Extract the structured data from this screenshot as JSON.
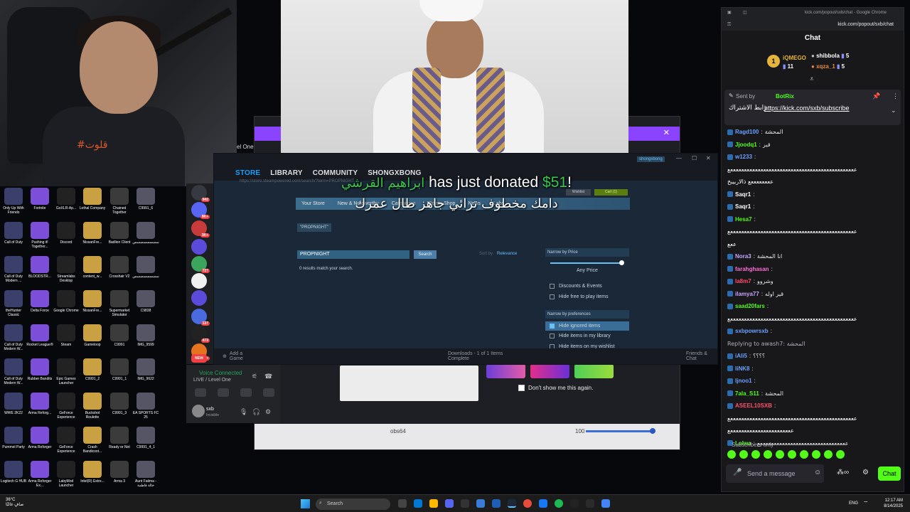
{
  "donation": {
    "name": "ابراهيم القرشي",
    "text": "has just donated",
    "amount": "$51",
    "exclaim": "!",
    "message": "دامك مخطوف ترائي جاهز طال عمرك"
  },
  "webcam": {
    "shirt_text": "#قلوت"
  },
  "steam": {
    "nav": [
      "STORE",
      "LIBRARY",
      "COMMUNITY",
      "SHONGXBONG"
    ],
    "url": "https://store.steampowered.com/search/?term=PROPNIGHT",
    "store_nav": [
      "Your Store",
      "New & Noteworthy",
      "Categories",
      "Points Shop",
      "News",
      "Labs"
    ],
    "wishlist": "Wishlist",
    "cart": "Cart (1)",
    "tag": "\"PROPNIGHT\"",
    "search_value": "PROPNIGHT",
    "search_btn": "Search",
    "sort_label": "Sort by",
    "sort_value": "Relevance",
    "no_results": "0 results match your search.",
    "price_head": "Narrow by Price",
    "any_price": "Any Price",
    "opt_discounts": "Discounts & Events",
    "opt_hide_free": "Hide free to play items",
    "pref_head": "Narrow by preferences",
    "opt_ignored": "Hide ignored items",
    "opt_library": "Hide items in my library",
    "opt_wishlist": "Hide items on my wishlist",
    "add_game": "Add a Game",
    "downloads": "Downloads - 1 of 1 Items Complete",
    "friends": "Friends & Chat",
    "user_pill": "shongxbong"
  },
  "obs": {
    "label": "obs64",
    "volume": "100",
    "dont_show": "Don't show me this again.",
    "window_title": "el One"
  },
  "discord": {
    "badges": [
      "942",
      "9K+",
      "3K+",
      "727",
      "137",
      "473",
      "9K+",
      "NEW"
    ],
    "voice_connected": "Voice Connected",
    "live_text": "LIVE / Level One",
    "user": "sxb",
    "status": "Invisible"
  },
  "desktop_icons": [
    "Only Up With Friends",
    "Fortnite",
    "GoXLR-Ap...",
    "Lethal Company",
    "Chained Together",
    "C9991_6",
    "Call of Duty",
    "Pushing it! Together...",
    "Discord",
    "NissanFre...",
    "Badlion Client",
    "سسسسسسسس",
    "Call of Duty Modern ...",
    "BLOODSTR...",
    "Streamlabs Desktop",
    "content_w...",
    "Crosshair V2",
    "سسسسسسسس",
    "theHunter Classic",
    "Delta Force",
    "Google Chrome",
    "NissanFre...",
    "Supermarket Simulator",
    "C9838",
    "Call of Duty Modern W...",
    "Rocket League®",
    "Steam",
    "Gameloop",
    "C9991",
    "IMG_9599",
    "Call of Duty Modern W...",
    "Rubber Bandits",
    "Epic Games Launcher",
    "C9991_2",
    "C9991_1",
    "IMG_9622",
    "WWE 2K22",
    "Arma Reforg...",
    "GeForce Experience",
    "Buckshot Roulette",
    "C9991_3",
    "EA SPORTS FC 25",
    "Pummel Party",
    "Arma Reforger",
    "GeForce Experience",
    "Crash Bandicoot...",
    "Ready or Not",
    "C9991_4_1",
    "Logitech G HUB",
    "Arma Reforger Ex...",
    "LabyMod Launcher",
    "Intel(R) Extre...",
    "Arma 3",
    "Aunt Fatima - خالة فاطمة"
  ],
  "chat": {
    "browser_url_small": "kick.com/popout/sxb/chat - Google Chrome",
    "browser_url": "kick.com/popout/sxb/chat",
    "title": "Chat",
    "leaderboard": {
      "first": "iQMEGO",
      "first_count": "11",
      "second": "shibbola",
      "second_count": "5",
      "third": "xqza_1",
      "third_count": "5",
      "rank": "1"
    },
    "pinned": {
      "sent_by": "Sent by",
      "bot": "BotRix",
      "label": "رابط الاشتراك",
      "link": "https://kick.com/sxb/subscribe"
    },
    "messages": [
      {
        "user": "Ragd100",
        "text": "المحشة",
        "color": "#6aa0ff"
      },
      {
        "user": "Jjoodq1",
        "text": "قير",
        "color": "#53fc18"
      },
      {
        "user": "w1233",
        "text": "",
        "color": "#6aa0ff"
      },
      {
        "user": "",
        "text": "ععععععععععععععععععععععععععععععععععععععععععععععع",
        "color": "#fff"
      },
      {
        "user": "",
        "text": "ععععععععع ذالاربيبخ",
        "color": "#fff"
      },
      {
        "user": "Saqr1",
        "text": "",
        "color": "#fff"
      },
      {
        "user": "Saqr1",
        "text": "",
        "color": "#fff"
      },
      {
        "user": "Hesa7",
        "text": "",
        "color": "#53fc18"
      },
      {
        "user": "",
        "text": "ععععععععععععععععععععععععععععععععععععععععععععععع",
        "color": "#fff"
      },
      {
        "user": "",
        "text": "ععع",
        "color": "#fff"
      },
      {
        "user": "Nora3",
        "text": "انا المحشة",
        "color": "#c8a2ff"
      },
      {
        "user": "farahghasan",
        "text": "",
        "color": "#ff6ad5"
      },
      {
        "user": "la8m7",
        "text": "وشروو",
        "color": "#ff4d6d"
      },
      {
        "user": "ilamya77",
        "text": "قير اوله",
        "color": "#c8a2ff"
      },
      {
        "user": "saad20fars",
        "text": "",
        "color": "#53fc18"
      },
      {
        "user": "",
        "text": "ععععععععععععععععععععععععععععععععععععععععععععععع",
        "color": "#fff"
      },
      {
        "user": "sxbpowrsxb",
        "text": "",
        "color": "#6aa0ff"
      },
      {
        "user": "",
        "text": "Replying to awash7: المحشة",
        "color": "#adadb8"
      },
      {
        "user": "iAli5",
        "text": "؟؟؟؟",
        "color": "#6aa0ff"
      },
      {
        "user": "liNK8",
        "text": "",
        "color": "#6aa0ff"
      },
      {
        "user": "ljnoo1",
        "text": "",
        "color": "#6aa0ff"
      },
      {
        "user": "7ala_S11",
        "text": "المحشة",
        "color": "#53fc18"
      },
      {
        "user": "ASEEL10SXB",
        "text": "",
        "color": "#ff4d6d"
      },
      {
        "user": "",
        "text": "ععععععععععععععععععععععععععععععععععععععععععععععع",
        "color": "#fff"
      },
      {
        "user": "",
        "text": "عععععععععععععععععععععععع",
        "color": "#fff"
      },
      {
        "user": "Lolwa",
        "text": "ععععععععععععععععععععععععععععععععع",
        "color": "#53fc18"
      }
    ],
    "subs_only": "Subscribers only",
    "placeholder": "Send a message",
    "send": "Chat"
  },
  "taskbar": {
    "temp": "36°C",
    "weather": "صافٍ غالبًا",
    "search": "Search",
    "lang": "ENG",
    "time": "12:17 AM",
    "date": "8/14/2025"
  }
}
